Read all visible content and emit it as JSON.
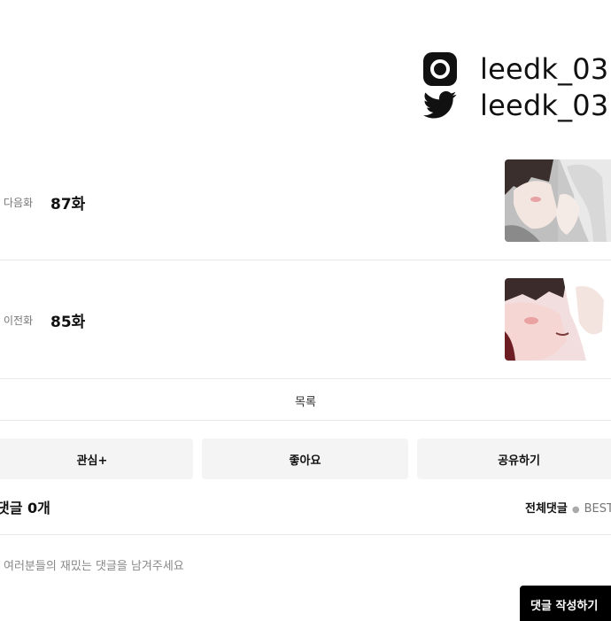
{
  "author_social": {
    "instagram": {
      "handle": "leedk_03",
      "icon": "instagram-icon"
    },
    "twitter": {
      "handle": "leedk_03",
      "icon": "twitter-icon"
    }
  },
  "episode_nav": {
    "next": {
      "label": "다음화",
      "title": "87화"
    },
    "prev": {
      "label": "이전화",
      "title": "85화"
    }
  },
  "list_link": "목록",
  "actions": {
    "like": "관심+",
    "good": "좋아요",
    "share": "공유하기"
  },
  "comments": {
    "title": "댓글 0개",
    "tab_all": "전체댓글",
    "tab_best": "BEST댓글",
    "placeholder": "여러분들의 재밌는 댓글을 남겨주세요",
    "submit": "댓글 작성하기"
  },
  "colors": {
    "button_bg": "#f4f4f4",
    "submit_bg": "#000000",
    "divider": "#e8e8e8"
  }
}
